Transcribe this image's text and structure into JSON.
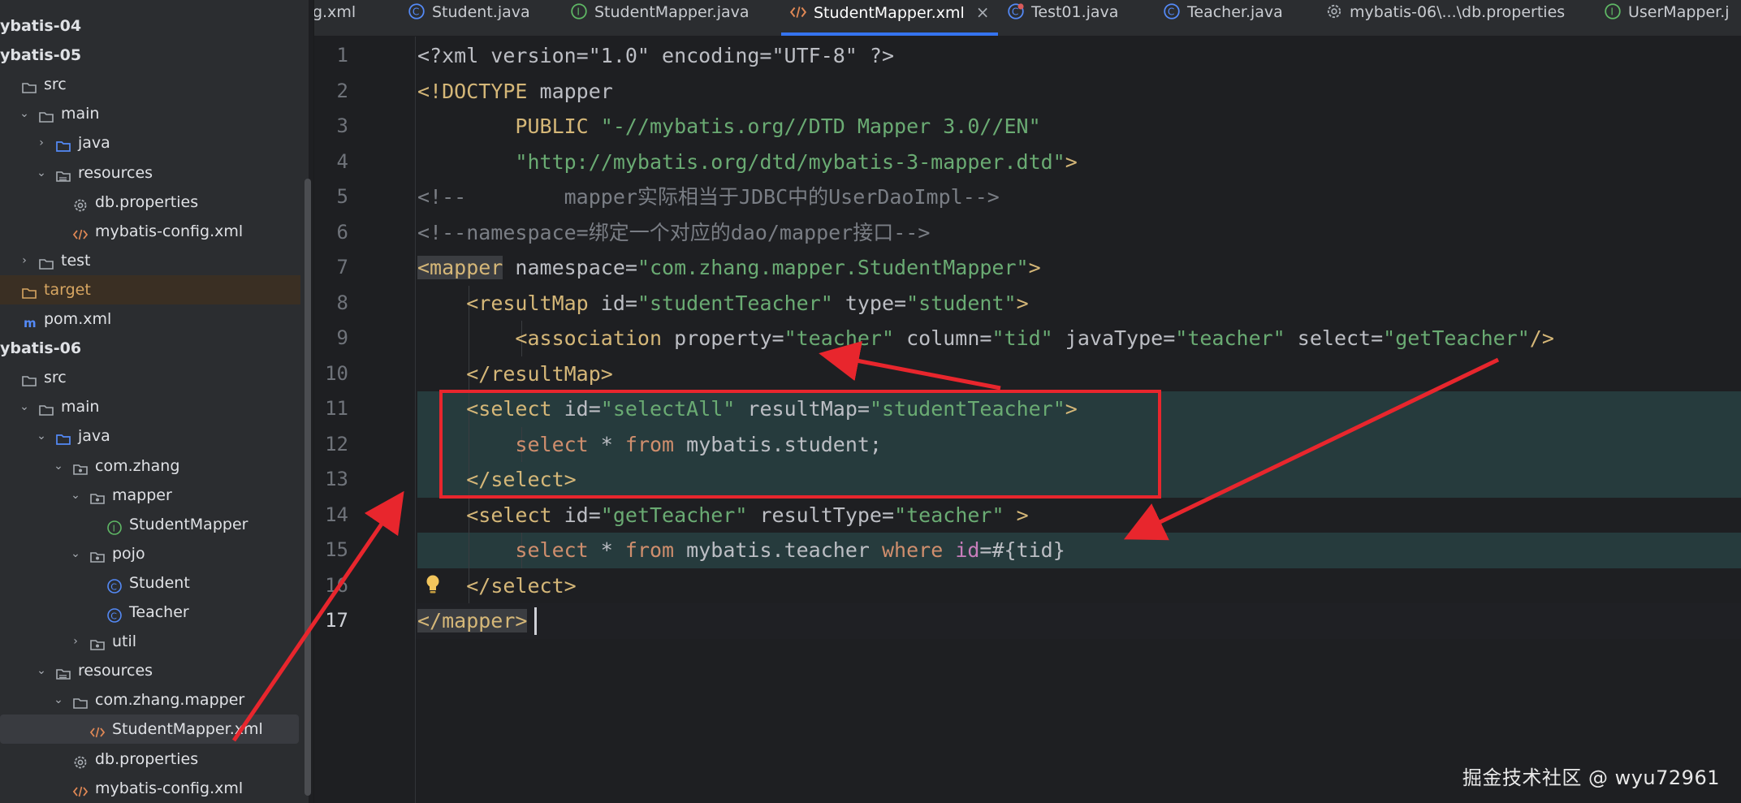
{
  "sidebar": {
    "items": [
      {
        "label": "ybatis-04",
        "bold": true,
        "icon": "module"
      },
      {
        "label": "ybatis-05",
        "bold": true,
        "icon": "module"
      },
      {
        "label": "src",
        "icon": "folder"
      },
      {
        "label": "main",
        "icon": "folder",
        "chevron": "down"
      },
      {
        "label": "java",
        "icon": "source-folder",
        "chevron": "right"
      },
      {
        "label": "resources",
        "icon": "resources-folder",
        "chevron": "down"
      },
      {
        "label": "db.properties",
        "icon": "gear"
      },
      {
        "label": "mybatis-config.xml",
        "icon": "xml"
      },
      {
        "label": "test",
        "icon": "folder",
        "chevron": "right"
      },
      {
        "label": "target",
        "icon": "excluded-folder"
      },
      {
        "label": "pom.xml",
        "icon": "maven"
      },
      {
        "label": "ybatis-06",
        "bold": true,
        "icon": "module"
      },
      {
        "label": "src",
        "icon": "folder"
      },
      {
        "label": "main",
        "icon": "folder",
        "chevron": "down"
      },
      {
        "label": "java",
        "icon": "source-folder",
        "chevron": "down"
      },
      {
        "label": "com.zhang",
        "icon": "package",
        "chevron": "down"
      },
      {
        "label": "mapper",
        "icon": "package",
        "chevron": "down"
      },
      {
        "label": "StudentMapper",
        "icon": "interface"
      },
      {
        "label": "pojo",
        "icon": "package",
        "chevron": "down"
      },
      {
        "label": "Student",
        "icon": "class"
      },
      {
        "label": "Teacher",
        "icon": "class"
      },
      {
        "label": "util",
        "icon": "package",
        "chevron": "right"
      },
      {
        "label": "resources",
        "icon": "resources-folder",
        "chevron": "down"
      },
      {
        "label": "com.zhang.mapper",
        "icon": "folder",
        "chevron": "down"
      },
      {
        "label": "StudentMapper.xml",
        "icon": "xml"
      },
      {
        "label": "db.properties",
        "icon": "gear"
      },
      {
        "label": "mybatis-config.xml",
        "icon": "xml"
      }
    ]
  },
  "tabs": [
    {
      "label": "g.xml",
      "icon": "none"
    },
    {
      "label": "Student.java",
      "icon": "class"
    },
    {
      "label": "StudentMapper.java",
      "icon": "interface"
    },
    {
      "label": "StudentMapper.xml",
      "icon": "xml",
      "active": true,
      "close": "×"
    },
    {
      "label": "Test01.java",
      "icon": "test-class"
    },
    {
      "label": "Teacher.java",
      "icon": "class"
    },
    {
      "label": "mybatis-06\\...\\db.properties",
      "icon": "gear"
    },
    {
      "label": "UserMapper.j",
      "icon": "interface"
    }
  ],
  "editor": {
    "line_numbers": [
      "1",
      "2",
      "3",
      "4",
      "5",
      "6",
      "7",
      "8",
      "9",
      "10",
      "11",
      "12",
      "13",
      "14",
      "15",
      "16",
      "17"
    ],
    "lines": [
      [
        {
          "t": "<?xml version=\"1.0\" encoding=\"UTF-8\" ?>",
          "c": "plain"
        }
      ],
      [
        {
          "t": "<!DOCTYPE ",
          "c": "tag"
        },
        {
          "t": "mapper",
          "c": "plain"
        }
      ],
      [
        {
          "t": "        PUBLIC ",
          "c": "tag"
        },
        {
          "t": "\"-//mybatis.org//DTD Mapper 3.0//EN\"",
          "c": "val"
        }
      ],
      [
        {
          "t": "        ",
          "c": "plain"
        },
        {
          "t": "\"http://mybatis.org/dtd/mybatis-3-mapper.dtd\"",
          "c": "val"
        },
        {
          "t": ">",
          "c": "tag"
        }
      ],
      [
        {
          "t": "<!--        mapper实际相当于JDBC中的UserDaoImpl-->",
          "c": "cmt"
        }
      ],
      [
        {
          "t": "<!--namespace=绑定一个对应的dao/mapper接口-->",
          "c": "cmt"
        }
      ],
      [
        {
          "t": "<mapper",
          "c": "tag tagbg"
        },
        {
          "t": " namespace",
          "c": "attr"
        },
        {
          "t": "=",
          "c": "plain"
        },
        {
          "t": "\"com.zhang.mapper.StudentMapper\"",
          "c": "val"
        },
        {
          "t": ">",
          "c": "tag"
        }
      ],
      [
        {
          "t": "    ",
          "c": "plain"
        },
        {
          "t": "<resultMap",
          "c": "tag"
        },
        {
          "t": " id",
          "c": "attr"
        },
        {
          "t": "=",
          "c": "plain"
        },
        {
          "t": "\"studentTeacher\"",
          "c": "val"
        },
        {
          "t": " type",
          "c": "attr"
        },
        {
          "t": "=",
          "c": "plain"
        },
        {
          "t": "\"student\"",
          "c": "val"
        },
        {
          "t": ">",
          "c": "tag"
        }
      ],
      [
        {
          "t": "        ",
          "c": "plain"
        },
        {
          "t": "<association",
          "c": "tag"
        },
        {
          "t": " property",
          "c": "attr"
        },
        {
          "t": "=",
          "c": "plain"
        },
        {
          "t": "\"teacher\"",
          "c": "val"
        },
        {
          "t": " column",
          "c": "attr"
        },
        {
          "t": "=",
          "c": "plain"
        },
        {
          "t": "\"tid\"",
          "c": "val"
        },
        {
          "t": " javaType",
          "c": "attr"
        },
        {
          "t": "=",
          "c": "plain"
        },
        {
          "t": "\"teacher\"",
          "c": "val"
        },
        {
          "t": " select",
          "c": "attr"
        },
        {
          "t": "=",
          "c": "plain"
        },
        {
          "t": "\"getTeacher\"",
          "c": "val"
        },
        {
          "t": "/>",
          "c": "tag"
        }
      ],
      [
        {
          "t": "    ",
          "c": "plain"
        },
        {
          "t": "</resultMap>",
          "c": "tag"
        }
      ],
      [
        {
          "t": "    ",
          "c": "plain"
        },
        {
          "t": "<select",
          "c": "tag"
        },
        {
          "t": " id",
          "c": "attr"
        },
        {
          "t": "=",
          "c": "plain"
        },
        {
          "t": "\"selectAll\"",
          "c": "val"
        },
        {
          "t": " resultMap",
          "c": "attr"
        },
        {
          "t": "=",
          "c": "plain"
        },
        {
          "t": "\"studentTeacher\"",
          "c": "val"
        },
        {
          "t": ">",
          "c": "tag"
        }
      ],
      [
        {
          "t": "        ",
          "c": "plain"
        },
        {
          "t": "select",
          "c": "kw"
        },
        {
          "t": " * ",
          "c": "plain"
        },
        {
          "t": "from",
          "c": "kw"
        },
        {
          "t": " mybatis.student;",
          "c": "plain"
        }
      ],
      [
        {
          "t": "    ",
          "c": "plain"
        },
        {
          "t": "</select>",
          "c": "tag"
        }
      ],
      [
        {
          "t": "    ",
          "c": "plain"
        },
        {
          "t": "<select",
          "c": "tag"
        },
        {
          "t": " id",
          "c": "attr"
        },
        {
          "t": "=",
          "c": "plain"
        },
        {
          "t": "\"getTeacher\"",
          "c": "val"
        },
        {
          "t": " resultType",
          "c": "attr"
        },
        {
          "t": "=",
          "c": "plain"
        },
        {
          "t": "\"teacher\"",
          "c": "val"
        },
        {
          "t": " >",
          "c": "tag"
        }
      ],
      [
        {
          "t": "        ",
          "c": "plain"
        },
        {
          "t": "select",
          "c": "kw"
        },
        {
          "t": " * ",
          "c": "plain"
        },
        {
          "t": "from",
          "c": "kw"
        },
        {
          "t": " mybatis.teacher ",
          "c": "plain"
        },
        {
          "t": "where",
          "c": "kw"
        },
        {
          "t": " ",
          "c": "plain"
        },
        {
          "t": "id",
          "c": "ident"
        },
        {
          "t": "=#{tid}",
          "c": "plain"
        }
      ],
      [
        {
          "t": "    ",
          "c": "plain"
        },
        {
          "t": "</select>",
          "c": "tag"
        }
      ],
      [
        {
          "t": "</mapper>",
          "c": "tag tagbg"
        }
      ]
    ]
  },
  "colors": {
    "accent": "#3574f0",
    "annotation_red": "#e8262d",
    "tag": "#d5b778",
    "string": "#6aab73",
    "comment": "#7a7e85",
    "keyword": "#cf8e6d"
  },
  "watermark": "掘金技术社区 @ wyu72961"
}
